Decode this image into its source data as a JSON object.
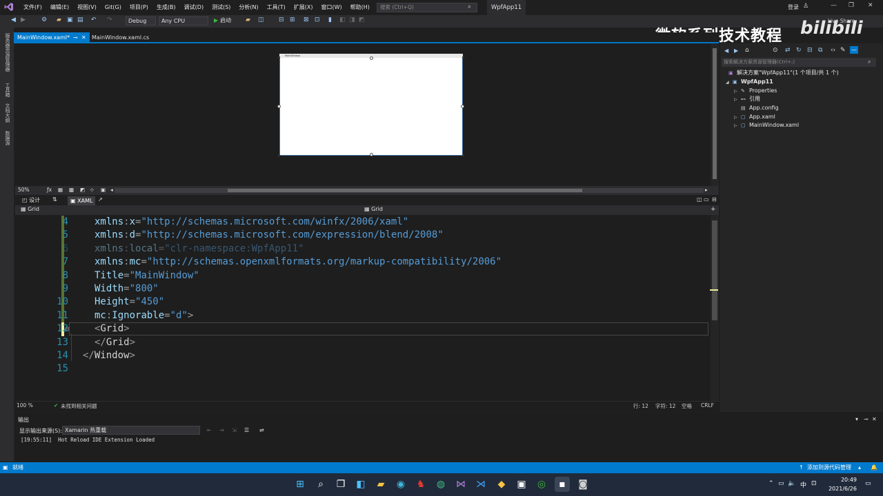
{
  "menu": [
    "文件(F)",
    "编辑(E)",
    "视图(V)",
    "Git(G)",
    "项目(P)",
    "生成(B)",
    "调试(D)",
    "测试(S)",
    "分析(N)",
    "工具(T)",
    "扩展(X)",
    "窗口(W)",
    "帮助(H)"
  ],
  "search": {
    "placeholder": "搜索 (Ctrl+Q)"
  },
  "solution_title": "WpfApp11",
  "signin": "登录",
  "toolbar": {
    "config": "Debug",
    "platform": "Any CPU",
    "start_label": "启动"
  },
  "watermark": {
    "text": "微软系列技术教程",
    "brand": "bilibili",
    "liveshare": "Live Share"
  },
  "left_strip": [
    "服务器资源管理器",
    "工具箱",
    "文档大纲",
    "数据源"
  ],
  "tabs": {
    "active": "MainWindow.xaml*",
    "inactive": "MainWindow.xaml.cs"
  },
  "designer": {
    "window_title": "MainWindow",
    "zoom": "50%"
  },
  "split": {
    "design_label": "设计",
    "xaml_label": "XAML"
  },
  "navbar": {
    "left": "Grid",
    "right": "Grid"
  },
  "code_lines": [
    {
      "n": "4",
      "parts": [
        [
          "attr",
          "xmlns"
        ],
        [
          "punc",
          ":"
        ],
        [
          "attr",
          "x"
        ],
        [
          "punc",
          "="
        ],
        [
          "str",
          "\"http://schemas.microsoft.com/winfx/2006/xaml\""
        ]
      ]
    },
    {
      "n": "5",
      "parts": [
        [
          "attr",
          "xmlns"
        ],
        [
          "punc",
          ":"
        ],
        [
          "attr",
          "d"
        ],
        [
          "punc",
          "="
        ],
        [
          "str",
          "\"http://schemas.microsoft.com/expression/blend/2008\""
        ]
      ]
    },
    {
      "n": "6",
      "dim": true,
      "parts": [
        [
          "attr",
          "xmlns"
        ],
        [
          "punc",
          ":"
        ],
        [
          "attr",
          "local"
        ],
        [
          "punc",
          "="
        ],
        [
          "str",
          "\"clr-namespace:WpfApp11\""
        ]
      ]
    },
    {
      "n": "7",
      "parts": [
        [
          "attr",
          "xmlns"
        ],
        [
          "punc",
          ":"
        ],
        [
          "attr",
          "mc"
        ],
        [
          "punc",
          "="
        ],
        [
          "str",
          "\"http://schemas.openxmlformats.org/markup-compatibility/2006\""
        ]
      ]
    },
    {
      "n": "8",
      "parts": [
        [
          "attr",
          "Title"
        ],
        [
          "punc",
          "="
        ],
        [
          "str",
          "\"MainWindow\""
        ]
      ]
    },
    {
      "n": "9",
      "parts": [
        [
          "attr",
          "Width"
        ],
        [
          "punc",
          "="
        ],
        [
          "str",
          "\"800\""
        ]
      ]
    },
    {
      "n": "10",
      "parts": [
        [
          "attr",
          "Height"
        ],
        [
          "punc",
          "="
        ],
        [
          "str",
          "\"450\""
        ]
      ]
    },
    {
      "n": "11",
      "parts": [
        [
          "attr",
          "mc"
        ],
        [
          "punc",
          ":"
        ],
        [
          "attr",
          "Ignorable"
        ],
        [
          "punc",
          "="
        ],
        [
          "str",
          "\"d\""
        ],
        [
          "punc",
          ">"
        ]
      ]
    },
    {
      "n": "12",
      "parts": [
        [
          "punc",
          "<"
        ],
        [
          "tag",
          "Grid"
        ],
        [
          "punc",
          ">"
        ]
      ]
    },
    {
      "n": "13",
      "parts": [
        [
          "punc",
          "</"
        ],
        [
          "tag",
          "Grid"
        ],
        [
          "punc",
          ">"
        ]
      ]
    },
    {
      "n": "14",
      "parts": [
        [
          "punc",
          "</"
        ],
        [
          "tag",
          "Window"
        ],
        [
          "punc",
          ">"
        ]
      ]
    },
    {
      "n": "15",
      "parts": []
    }
  ],
  "editor_status": {
    "zoom": "100 %",
    "issues": "未找到相关问题",
    "line": "行: 12",
    "char": "字符: 12",
    "spaces": "空格",
    "eol": "CRLF"
  },
  "output": {
    "title": "输出",
    "source_label": "显示输出来源(S):",
    "source_value": "Xamarin 热重载",
    "line": "[19:55:11]  Hot Reload IDE Extension Loaded"
  },
  "solution_explorer": {
    "search_placeholder": "搜索解决方案资源管理器(Ctrl+;)",
    "items": [
      {
        "label": "解决方案\"WpfApp11\"(1 个项目/共 1 个)"
      },
      {
        "label": "WpfApp11"
      },
      {
        "label": "Properties"
      },
      {
        "label": "引用"
      },
      {
        "label": "App.config"
      },
      {
        "label": "App.xaml"
      },
      {
        "label": "MainWindow.xaml"
      }
    ]
  },
  "status": {
    "ready": "就绪",
    "scm": "添加到源代码管理"
  },
  "clock": {
    "time": "20:49",
    "date": "2021/6/26"
  },
  "tray": {
    "ime": "中"
  }
}
